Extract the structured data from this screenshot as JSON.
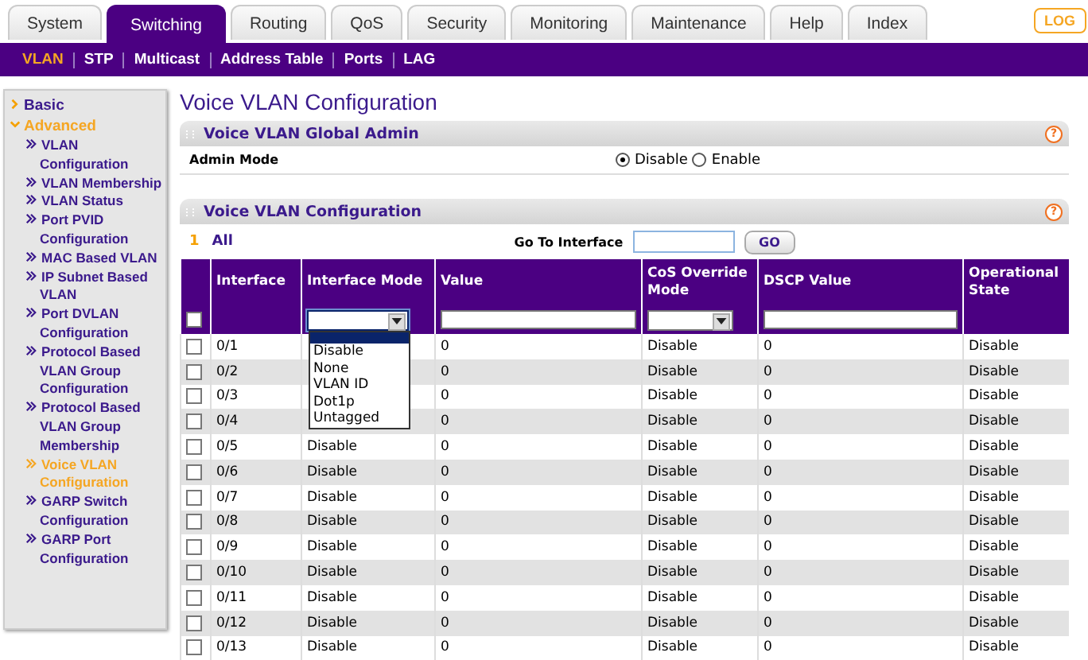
{
  "tabs": [
    {
      "label": "System",
      "selected": false
    },
    {
      "label": "Switching",
      "selected": true
    },
    {
      "label": "Routing",
      "selected": false
    },
    {
      "label": "QoS",
      "selected": false
    },
    {
      "label": "Security",
      "selected": false
    },
    {
      "label": "Monitoring",
      "selected": false
    },
    {
      "label": "Maintenance",
      "selected": false
    },
    {
      "label": "Help",
      "selected": false
    },
    {
      "label": "Index",
      "selected": false
    }
  ],
  "logout_button": "LOG",
  "subnav": [
    {
      "label": "VLAN",
      "selected": true
    },
    {
      "label": "STP",
      "selected": false
    },
    {
      "label": "Multicast",
      "selected": false
    },
    {
      "label": "Address Table",
      "selected": false
    },
    {
      "label": "Ports",
      "selected": false
    },
    {
      "label": "LAG",
      "selected": false
    }
  ],
  "sidebar": {
    "items": [
      {
        "label": "Basic",
        "expanded": false
      },
      {
        "label": "Advanced",
        "expanded": true,
        "children": [
          {
            "label": "VLAN Configuration",
            "selected": false
          },
          {
            "label": "VLAN Membership",
            "selected": false
          },
          {
            "label": "VLAN Status",
            "selected": false
          },
          {
            "label": "Port PVID Configuration",
            "selected": false
          },
          {
            "label": "MAC Based VLAN",
            "selected": false
          },
          {
            "label": "IP Subnet Based VLAN",
            "selected": false
          },
          {
            "label": "Port DVLAN Configuration",
            "selected": false
          },
          {
            "label": "Protocol Based VLAN Group Configuration",
            "selected": false
          },
          {
            "label": "Protocol Based VLAN Group Membership",
            "selected": false
          },
          {
            "label": "Voice VLAN Configuration",
            "selected": true
          },
          {
            "label": "GARP Switch Configuration",
            "selected": false
          },
          {
            "label": "GARP Port Configuration",
            "selected": false
          }
        ]
      }
    ]
  },
  "page_title": "Voice VLAN Configuration",
  "global_admin": {
    "title": "Voice VLAN Global Admin",
    "help": "?",
    "field_label": "Admin Mode",
    "options": [
      {
        "label": "Disable",
        "selected": true
      },
      {
        "label": "Enable",
        "selected": false
      }
    ]
  },
  "config": {
    "title": "Voice VLAN Configuration",
    "help": "?",
    "page": "1",
    "all_link": "All",
    "go_to_label": "Go To Interface",
    "go_button": "GO",
    "columns": [
      "Interface",
      "Interface Mode",
      "Value",
      "CoS Override Mode",
      "DSCP Value",
      "Operational State"
    ],
    "select_all_checked": false,
    "mode_dropdown": {
      "expanded": true,
      "options": [
        {
          "label": "Disable",
          "selected": false
        },
        {
          "label": "None",
          "selected": false
        },
        {
          "label": "VLAN ID",
          "selected": false
        },
        {
          "label": "Dot1p",
          "selected": false
        },
        {
          "label": "Untagged",
          "selected": false
        }
      ]
    },
    "rows": [
      {
        "checked": false,
        "interface": "0/1",
        "value": "0",
        "cos_override_mode": "Disable",
        "dscp_value": "0",
        "operational_state": "Disable"
      },
      {
        "checked": false,
        "interface": "0/2",
        "value": "0",
        "cos_override_mode": "Disable",
        "dscp_value": "0",
        "operational_state": "Disable"
      },
      {
        "checked": false,
        "interface": "0/3",
        "value": "0",
        "cos_override_mode": "Disable",
        "dscp_value": "0",
        "operational_state": "Disable"
      },
      {
        "checked": false,
        "interface": "0/4",
        "value": "0",
        "cos_override_mode": "Disable",
        "dscp_value": "0",
        "operational_state": "Disable"
      },
      {
        "checked": false,
        "interface": "0/5",
        "interface_mode": "Disable",
        "value": "0",
        "cos_override_mode": "Disable",
        "dscp_value": "0",
        "operational_state": "Disable"
      },
      {
        "checked": false,
        "interface": "0/6",
        "interface_mode": "Disable",
        "value": "0",
        "cos_override_mode": "Disable",
        "dscp_value": "0",
        "operational_state": "Disable"
      },
      {
        "checked": false,
        "interface": "0/7",
        "interface_mode": "Disable",
        "value": "0",
        "cos_override_mode": "Disable",
        "dscp_value": "0",
        "operational_state": "Disable"
      },
      {
        "checked": false,
        "interface": "0/8",
        "interface_mode": "Disable",
        "value": "0",
        "cos_override_mode": "Disable",
        "dscp_value": "0",
        "operational_state": "Disable"
      },
      {
        "checked": false,
        "interface": "0/9",
        "interface_mode": "Disable",
        "value": "0",
        "cos_override_mode": "Disable",
        "dscp_value": "0",
        "operational_state": "Disable"
      },
      {
        "checked": false,
        "interface": "0/10",
        "interface_mode": "Disable",
        "value": "0",
        "cos_override_mode": "Disable",
        "dscp_value": "0",
        "operational_state": "Disable"
      },
      {
        "checked": false,
        "interface": "0/11",
        "interface_mode": "Disable",
        "value": "0",
        "cos_override_mode": "Disable",
        "dscp_value": "0",
        "operational_state": "Disable"
      },
      {
        "checked": false,
        "interface": "0/12",
        "interface_mode": "Disable",
        "value": "0",
        "cos_override_mode": "Disable",
        "dscp_value": "0",
        "operational_state": "Disable"
      },
      {
        "checked": false,
        "interface": "0/13",
        "interface_mode": "Disable",
        "value": "0",
        "cos_override_mode": "Disable",
        "dscp_value": "0",
        "operational_state": "Disable"
      }
    ]
  }
}
